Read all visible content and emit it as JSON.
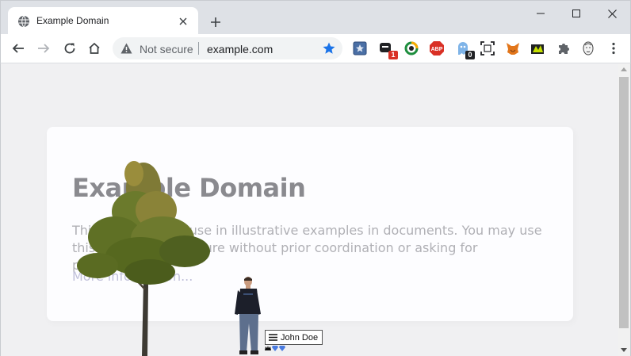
{
  "tab": {
    "title": "Example Domain"
  },
  "omnibox": {
    "security_label": "Not secure",
    "url": "example.com"
  },
  "extensions": [
    {
      "name": "bookmark-extension-icon",
      "badge": ""
    },
    {
      "name": "messenger-extension-icon",
      "badge": "1",
      "badge_color": "#d93025"
    },
    {
      "name": "sync-extension-icon",
      "badge": ""
    },
    {
      "name": "adblock-plus-icon",
      "label": "ABP",
      "badge": ""
    },
    {
      "name": "ghost-extension-icon",
      "badge": "0",
      "badge_color": "#202124"
    },
    {
      "name": "screenshot-extension-icon",
      "badge": ""
    },
    {
      "name": "metamask-fox-icon",
      "badge": ""
    },
    {
      "name": "lime-extension-icon",
      "badge": ""
    },
    {
      "name": "extensions-puzzle-icon",
      "badge": ""
    },
    {
      "name": "profile-avatar-icon",
      "badge": ""
    },
    {
      "name": "more-menu-icon",
      "badge": ""
    }
  ],
  "page": {
    "heading": "Example Domain",
    "paragraph": "This domain is for use in illustrative examples in documents. You may use this domain in literature without prior coordination or asking for permission.",
    "link": "More information..."
  },
  "overlay": {
    "player_name": "John Doe"
  },
  "colors": {
    "accent": "#1a73e8",
    "tab_strip": "#dee1e6",
    "page_bg": "#f0f0f2"
  }
}
